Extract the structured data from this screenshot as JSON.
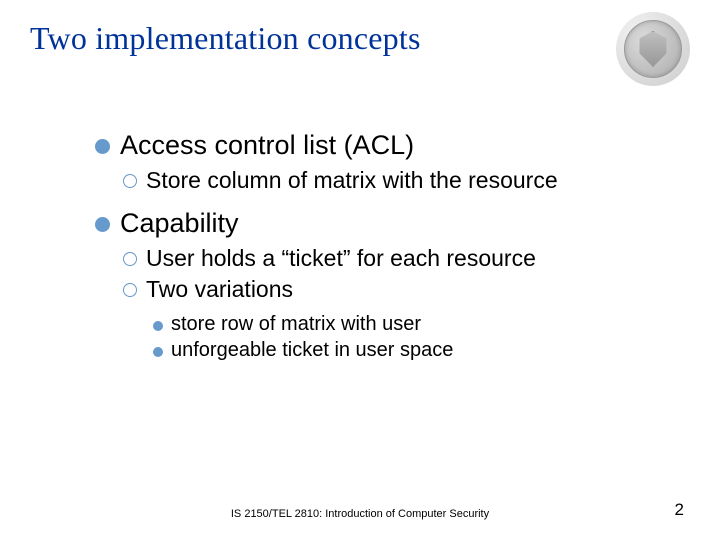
{
  "title": "Two implementation concepts",
  "footer": {
    "course": "IS 2150/TEL 2810: Introduction of Computer Security",
    "page": "2"
  },
  "items": {
    "b1": {
      "title": "Access control list (ACL)"
    },
    "b1s1": "Store column of matrix with the resource",
    "b2": {
      "title": "Capability"
    },
    "b2s1": "User holds a “ticket” for each resource",
    "b2s2": "Two variations",
    "b2s2a": "store row of matrix with user",
    "b2s2b": "unforgeable ticket in user space"
  }
}
